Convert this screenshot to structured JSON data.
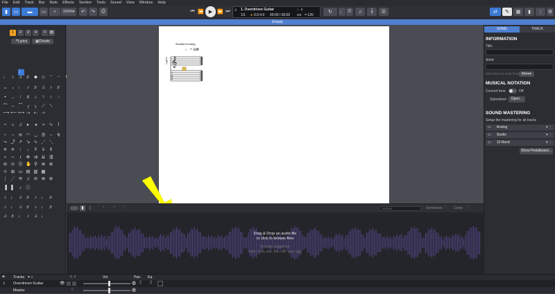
{
  "menu": [
    "File",
    "Edit",
    "Track",
    "Bar",
    "Note",
    "Effects",
    "Section",
    "Tools",
    "Sound",
    "View",
    "Window",
    "Help"
  ],
  "toolbar": {
    "zoom": "100%",
    "track_name": "1. Overdriven Guitar",
    "bar_pos": "1/1",
    "bar_sig": "0.0:4.0",
    "time": "00:00 / 00:02",
    "tempo": "= 120"
  },
  "file_title": "Empty",
  "left": {
    "voice_tabs": [
      "1",
      "2",
      "3",
      "4"
    ],
    "lyrics": "Lyrics",
    "chords": "Chords",
    "text_tool": "TXT",
    "tuning_tool": "2.5t"
  },
  "score": {
    "tuning": "Standard tuning",
    "tempo": "= 120",
    "instrument": "s.guit.",
    "clef_tab": "TAB"
  },
  "audio_bar": {
    "search_placeholder": "Vertical",
    "semitones": "Semitones",
    "cents": "Cents"
  },
  "wave": {
    "drop1": "Drag & Drop an audio file",
    "drop2": "or click to browse files",
    "fmt1": "Formats supported:",
    "fmt2": "mp3, m4a, aac, flac, aiff, wav, ogg"
  },
  "right": {
    "tab_song": "SONG",
    "tab_track": "TRACK",
    "info_h": "INFORMATION",
    "title_lbl": "Title:",
    "artist_lbl": "Artist:",
    "click_hint": "Click here for more lines",
    "more": "More",
    "notation_h": "MUSICAL NOTATION",
    "concert_tone": "Concert tone",
    "off": "Off",
    "stylesheet": "Stylesheet:",
    "open": "Open...",
    "mastering_h": "SOUND MASTERING",
    "mastering_sub": "Setup the mastering for all tracks",
    "effects": [
      "Analog",
      "Studio",
      "10-Band"
    ],
    "pedalboard": "Show Pedalboard..."
  },
  "tracks": {
    "header": "Tracks",
    "vol": "Vol.",
    "pan": "Pan.",
    "eq": "Eq.",
    "track1": "Overdriven Guitar",
    "master": "Master"
  },
  "colors": {
    "accent": "#4f7fd0",
    "wave": "#5a4a96",
    "arrow": "#ffff00"
  }
}
